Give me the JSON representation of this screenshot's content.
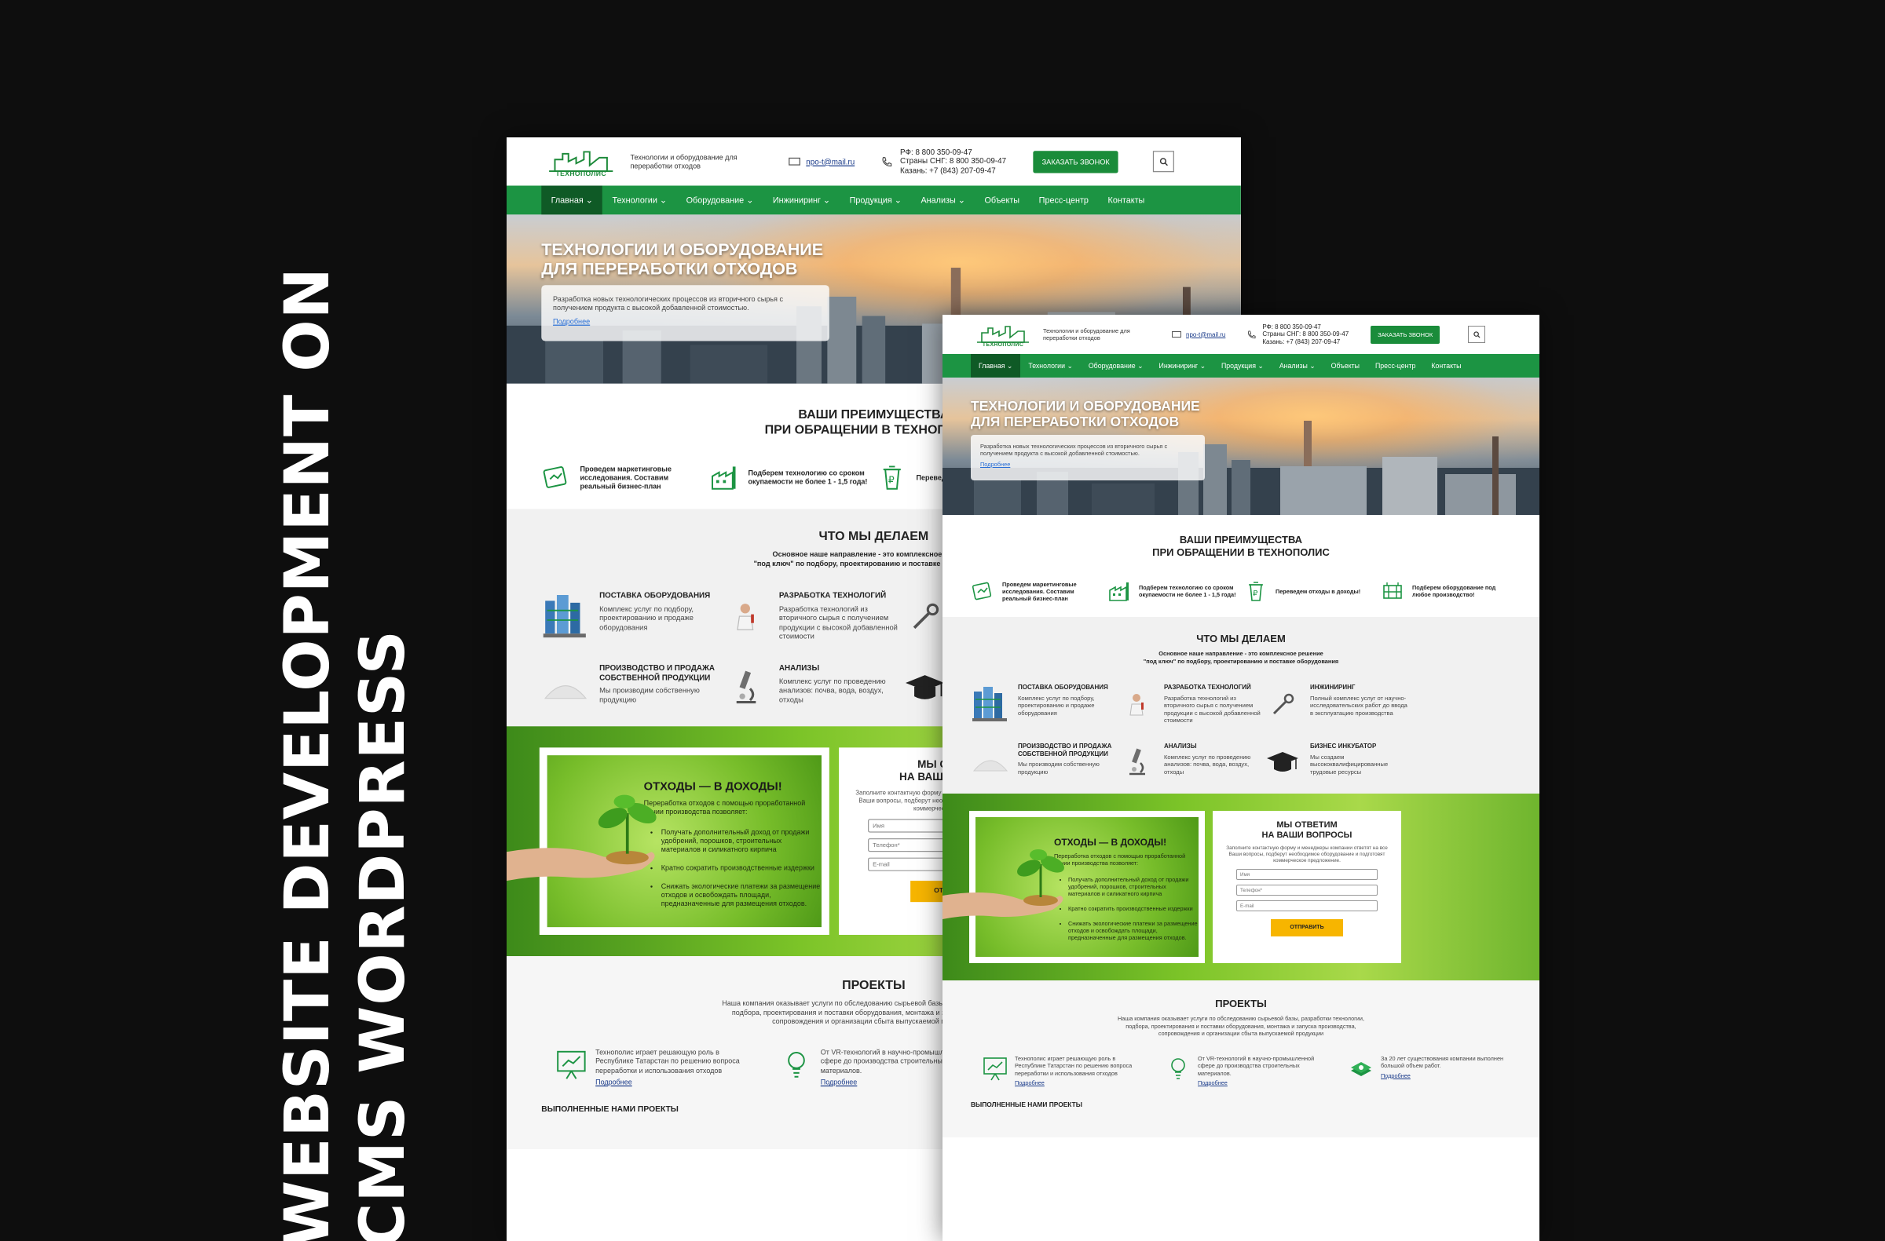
{
  "title_lines": [
    "WEBSITE DEVELOPMENT ON",
    "CMS WORDPRESS"
  ],
  "site": {
    "logo_text": "ТЕХНОПОЛИС",
    "tagline": "Технологии и оборудование для переработки отходов",
    "email": "npo-t@mail.ru",
    "phones": [
      "РФ: 8 800 350-09-47",
      "Страны СНГ: 8 800 350-09-47",
      "Казань: +7 (843) 207-09-47"
    ],
    "call_button": "ЗАКАЗАТЬ ЗВОНОК",
    "nav": [
      "Главная",
      "Технологии",
      "Оборудование",
      "Инжиниринг",
      "Продукция",
      "Анализы",
      "Объекты",
      "Пресс-центр",
      "Контакты"
    ],
    "hero": {
      "title_l1": "ТЕХНОЛОГИИ И ОБОРУДОВАНИЕ",
      "title_l2": "ДЛЯ ПЕРЕРАБОТКИ ОТХОДОВ",
      "text": "Разработка новых технологических процессов из вторичного сырья с получением продукта с высокой добавленной стоимостью.",
      "more": "Подробнее"
    },
    "advantages": {
      "title_l1": "ВАШИ ПРЕИМУЩЕСТВА",
      "title_l2": "ПРИ ОБРАЩЕНИИ В ТЕХНОПОЛИС",
      "items": [
        "Проведем маркетинговые исследования. Составим реальный бизнес-план",
        "Подберем технологию со сроком окупаемости не более 1 - 1,5 года!",
        "Переведем отходы в доходы!",
        "Подберем оборудование под любое производство!"
      ]
    },
    "what": {
      "title": "ЧТО МЫ ДЕЛАЕМ",
      "sub_l1": "Основное наше направление - это комплексное решение",
      "sub_l2": "\"под ключ\" по подбору, проектированию и поставке оборудования",
      "services": [
        {
          "title": "ПОСТАВКА ОБОРУДОВАНИЯ",
          "desc": "Комплекс услуг по подбору, проектированию и продаже оборудования"
        },
        {
          "title": "РАЗРАБОТКА ТЕХНОЛОГИЙ",
          "desc": "Разработка технологий из вторичного сырья с получением продукции с высокой добавленной стоимости"
        },
        {
          "title": "ИНЖИНИРИНГ",
          "desc": "Полный комплекс услуг от научно-исследовательских работ до ввода в эксплуатацию производства"
        },
        {
          "title": "ПРОИЗВОДСТВО И ПРОДАЖА СОБСТВЕННОЙ ПРОДУКЦИИ",
          "desc": "Мы производим собственную продукцию"
        },
        {
          "title": "АНАЛИЗЫ",
          "desc": "Комплекс услуг по проведению анализов: почва, вода, воздух, отходы"
        },
        {
          "title": "БИЗНЕС ИНКУБАТОР",
          "desc": "Мы создаем высококвалифицированные трудовые ресурсы"
        }
      ]
    },
    "waste": {
      "title": "ОТХОДЫ — В ДОХОДЫ!",
      "intro": "Переработка отходов с помощью проработанной линии производства позволяет:",
      "bullets": [
        "Получать дополнительный доход от продажи удобрений, порошков, строительных материалов и силикатного кирпича",
        "Кратно сократить производственные издержки",
        "Снижать экологические платежи за размещение отходов и освобождать площади, предназначенные для размещения отходов."
      ]
    },
    "form": {
      "title_l1": "МЫ ОТВЕТИМ",
      "title_l2": "НА ВАШИ ВОПРОСЫ",
      "desc": "Заполните контактную форму и менеджеры компании ответят на все Ваши вопросы, подберут необходимое оборудование и подготовят коммерческое предложение.",
      "name_ph": "Имя",
      "phone_ph": "Телефон*",
      "email_ph": "E-mail",
      "submit": "ОТПРАВИТЬ"
    },
    "projects": {
      "title": "ПРОЕКТЫ",
      "desc": "Наша компания оказывает услуги по обследованию сырьевой базы, разработки технологии, подбора, проектирования и поставки оборудования, монтажа и запуска производства, сопровождения и организации сбыта выпускаемой продукции",
      "items": [
        "Технополис играет решающую роль в Республике Татарстан по решению вопроса переработки и использования отходов",
        "От VR-технологий в научно-промышленной сфере до производства строительных материалов.",
        "За 20 лет существования компании выполнен большой объем работ."
      ],
      "more": "Подробнее",
      "done_title": "ВЫПОЛНЕННЫЕ НАМИ ПРОЕКТЫ"
    }
  },
  "colors": {
    "background": "#0e0e0e",
    "brand_green": "#1c9443",
    "button_yellow": "#f7b500"
  }
}
